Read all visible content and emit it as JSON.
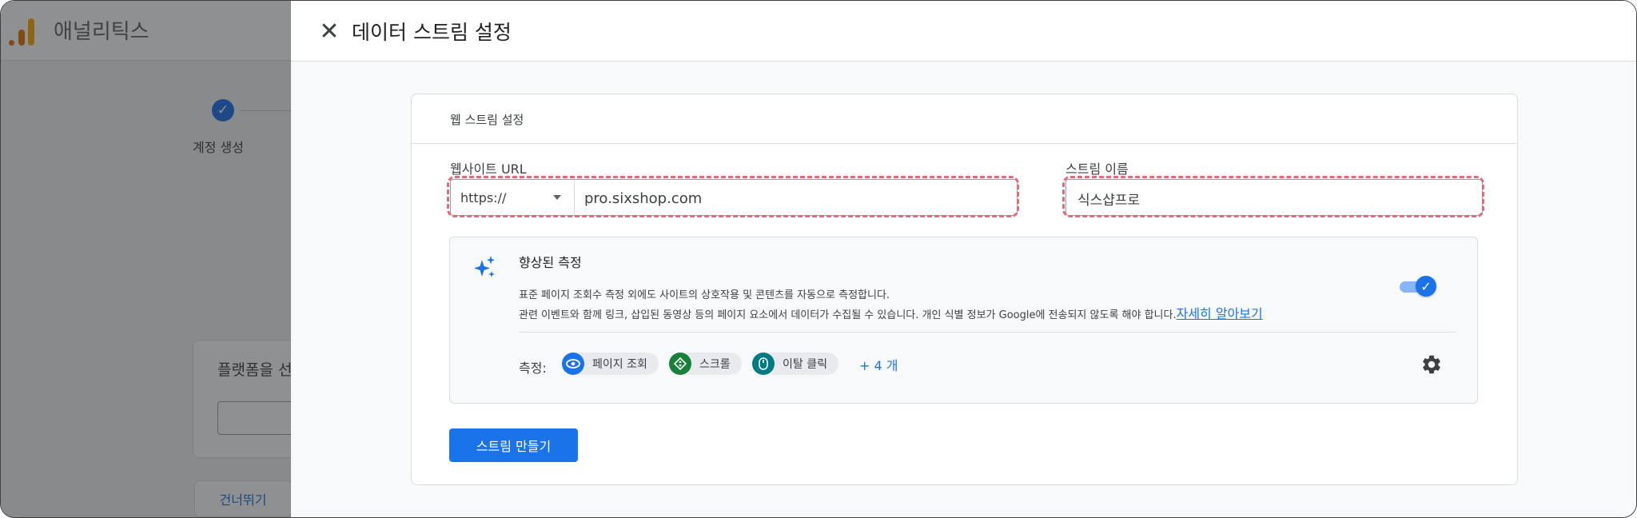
{
  "background": {
    "app_title": "애널리틱스",
    "step_label": "계정 생성",
    "card_title": "플랫폼을 선",
    "skip_label": "건너뛰기"
  },
  "drawer": {
    "title": "데이터 스트림 설정",
    "close_icon": "close-icon",
    "panel_title": "웹 스트림 설정",
    "website_url": {
      "label": "웹사이트 URL",
      "protocol": "https://",
      "value": "pro.sixshop.com"
    },
    "stream_name": {
      "label": "스트림 이름",
      "value": "식스샵프로"
    },
    "enhanced": {
      "title": "향상된 측정",
      "desc_line1": "표준 페이지 조회수 측정 외에도 사이트의 상호작용 및 콘텐츠를 자동으로 측정합니다.",
      "desc_line2": "관련 이벤트와 함께 링크, 삽입된 동영상 등의 페이지 요소에서 데이터가 수집될 수 있습니다. 개인 식별 정보가 Google에 전송되지 않도록 해야 합니다.",
      "learn_more": "자세히 알아보기",
      "toggle_on": true,
      "measure_label": "측정:",
      "chips": [
        {
          "label": "페이지 조회",
          "icon": "eye-icon",
          "color": "#1a73e8"
        },
        {
          "label": "스크롤",
          "icon": "scroll-icon",
          "color": "#188038"
        },
        {
          "label": "이탈 클릭",
          "icon": "mouse-icon",
          "color": "#007b83"
        }
      ],
      "more": "+ 4 개"
    },
    "create_button": "스트림 만들기"
  },
  "colors": {
    "accent": "#1a73e8",
    "highlight": "#e06c78"
  }
}
